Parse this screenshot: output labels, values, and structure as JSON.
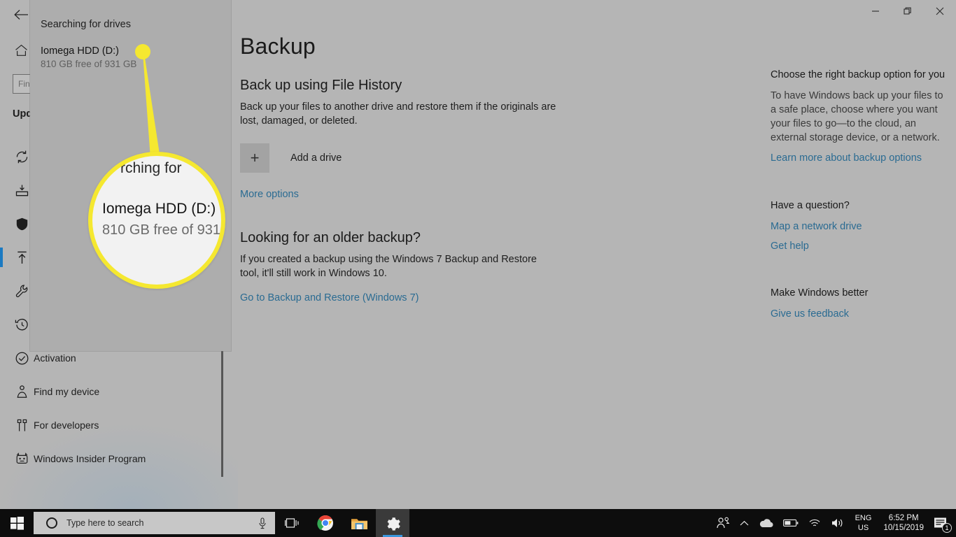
{
  "window": {
    "controls": {
      "minimize": "Minimize",
      "restore": "Restore",
      "close": "Close"
    }
  },
  "nav": {
    "back_label": "Back",
    "home_label": "Home",
    "search_value": "Fin",
    "search_placeholder": "Find a setting",
    "header": "Upd",
    "items": [
      {
        "icon": "sync-icon",
        "label": ""
      },
      {
        "icon": "delivery-optimization-icon",
        "label": ""
      },
      {
        "icon": "shield-icon",
        "label": ""
      },
      {
        "icon": "backup-upload-icon",
        "label": "",
        "selected": true
      },
      {
        "icon": "wrench-icon",
        "label": ""
      },
      {
        "icon": "recovery-clock-icon",
        "label": ""
      },
      {
        "icon": "activation-check-icon",
        "label": "Activation"
      },
      {
        "icon": "find-my-device-icon",
        "label": "Find my device"
      },
      {
        "icon": "for-developers-icon",
        "label": "For developers"
      },
      {
        "icon": "windows-insider-icon",
        "label": "Windows Insider Program"
      }
    ]
  },
  "main": {
    "page_title": "Backup",
    "file_history": {
      "heading": "Back up using File History",
      "description": "Back up your files to another drive and restore them if the originals are lost, damaged, or deleted.",
      "add_drive_label": "Add a drive",
      "plus_glyph": "+",
      "more_options_label": "More options"
    },
    "older_backup": {
      "heading": "Looking for an older backup?",
      "description": "If you created a backup using the Windows 7 Backup and Restore tool, it'll still work in Windows 10.",
      "link_label": "Go to Backup and Restore (Windows 7)"
    }
  },
  "aside": {
    "choose_option": {
      "heading": "Choose the right backup option for you",
      "body": "To have Windows back up your files to a safe place, choose where you want your files to go—to the cloud, an external storage device, or a network.",
      "link": "Learn more about backup options"
    },
    "question": {
      "heading": "Have a question?",
      "links": [
        "Map a network drive",
        "Get help"
      ]
    },
    "feedback": {
      "heading": "Make Windows better",
      "links": [
        "Give us feedback"
      ]
    }
  },
  "flyout": {
    "title": "Searching for drives",
    "drives": [
      {
        "name": "Iomega HDD (D:)",
        "free": "810 GB free of 931 GB"
      }
    ]
  },
  "magnifier": {
    "line_top": "rching for",
    "line_1": "Iomega HDD (D:)",
    "line_2": "810 GB free of 931",
    "ring_color": "#f5e830"
  },
  "taskbar": {
    "start_label": "Start",
    "search_placeholder": "Type here to search",
    "mic_label": "Cortana microphone",
    "buttons": [
      {
        "name": "task-view",
        "label": "Task View"
      },
      {
        "name": "chrome",
        "label": "Google Chrome"
      },
      {
        "name": "file-explorer",
        "label": "File Explorer"
      },
      {
        "name": "settings",
        "label": "Settings"
      }
    ],
    "tray": {
      "people_label": "People",
      "chevron_label": "Show hidden icons",
      "onedrive_label": "OneDrive",
      "battery_label": "Battery",
      "network_label": "Network",
      "volume_label": "Volume",
      "lang_line1": "ENG",
      "lang_line2": "US",
      "time": "6:52 PM",
      "date": "10/15/2019",
      "action_center_badge": "1"
    }
  },
  "colors": {
    "accent": "#1b7ac2",
    "link": "#2a6b92",
    "callout": "#f5e830",
    "window_bg": "#b5b5b5",
    "flyout_bg": "#adadad"
  }
}
